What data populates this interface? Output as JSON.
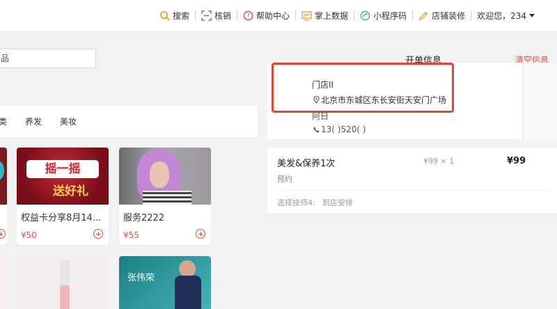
{
  "topnav": {
    "items": [
      {
        "label": "搜索",
        "icon": "search-icon"
      },
      {
        "label": "核销",
        "icon": "scan-icon"
      },
      {
        "label": "帮助中心",
        "icon": "help-icon"
      },
      {
        "label": "掌上数据",
        "icon": "chart-icon"
      },
      {
        "label": "小程序码",
        "icon": "miniprogram-icon"
      },
      {
        "label": "店铺装修",
        "icon": "brush-icon"
      }
    ],
    "user": "欢迎您，234",
    "accent_color": "#e8a23a"
  },
  "left": {
    "search_text": "品",
    "categories": [
      "类",
      "养发",
      "美妆"
    ],
    "products": [
      {
        "name": "权益卡分享8月14...",
        "price": "¥50",
        "banner_line1": "摇一摇",
        "banner_line2": "送好礼"
      },
      {
        "name": "服务2222",
        "price": "¥55"
      }
    ],
    "promo_card_text": "张伟荣"
  },
  "order": {
    "title": "开单信息",
    "clear_label": "清空信息",
    "store_name": "门店II",
    "store_address": "北京市东城区东长安街天安门广场",
    "shop_label": "阿日",
    "phone": "13(  )520(  )",
    "service": {
      "name": "美发&保养1次",
      "qty": "¥99 × 1",
      "price": "¥99",
      "type": "预约",
      "tech_label": "选择技师4:",
      "tech_value": "到店安排"
    }
  },
  "colors": {
    "price_red": "#e64c3c",
    "highlight_frame": "#e2472c"
  }
}
